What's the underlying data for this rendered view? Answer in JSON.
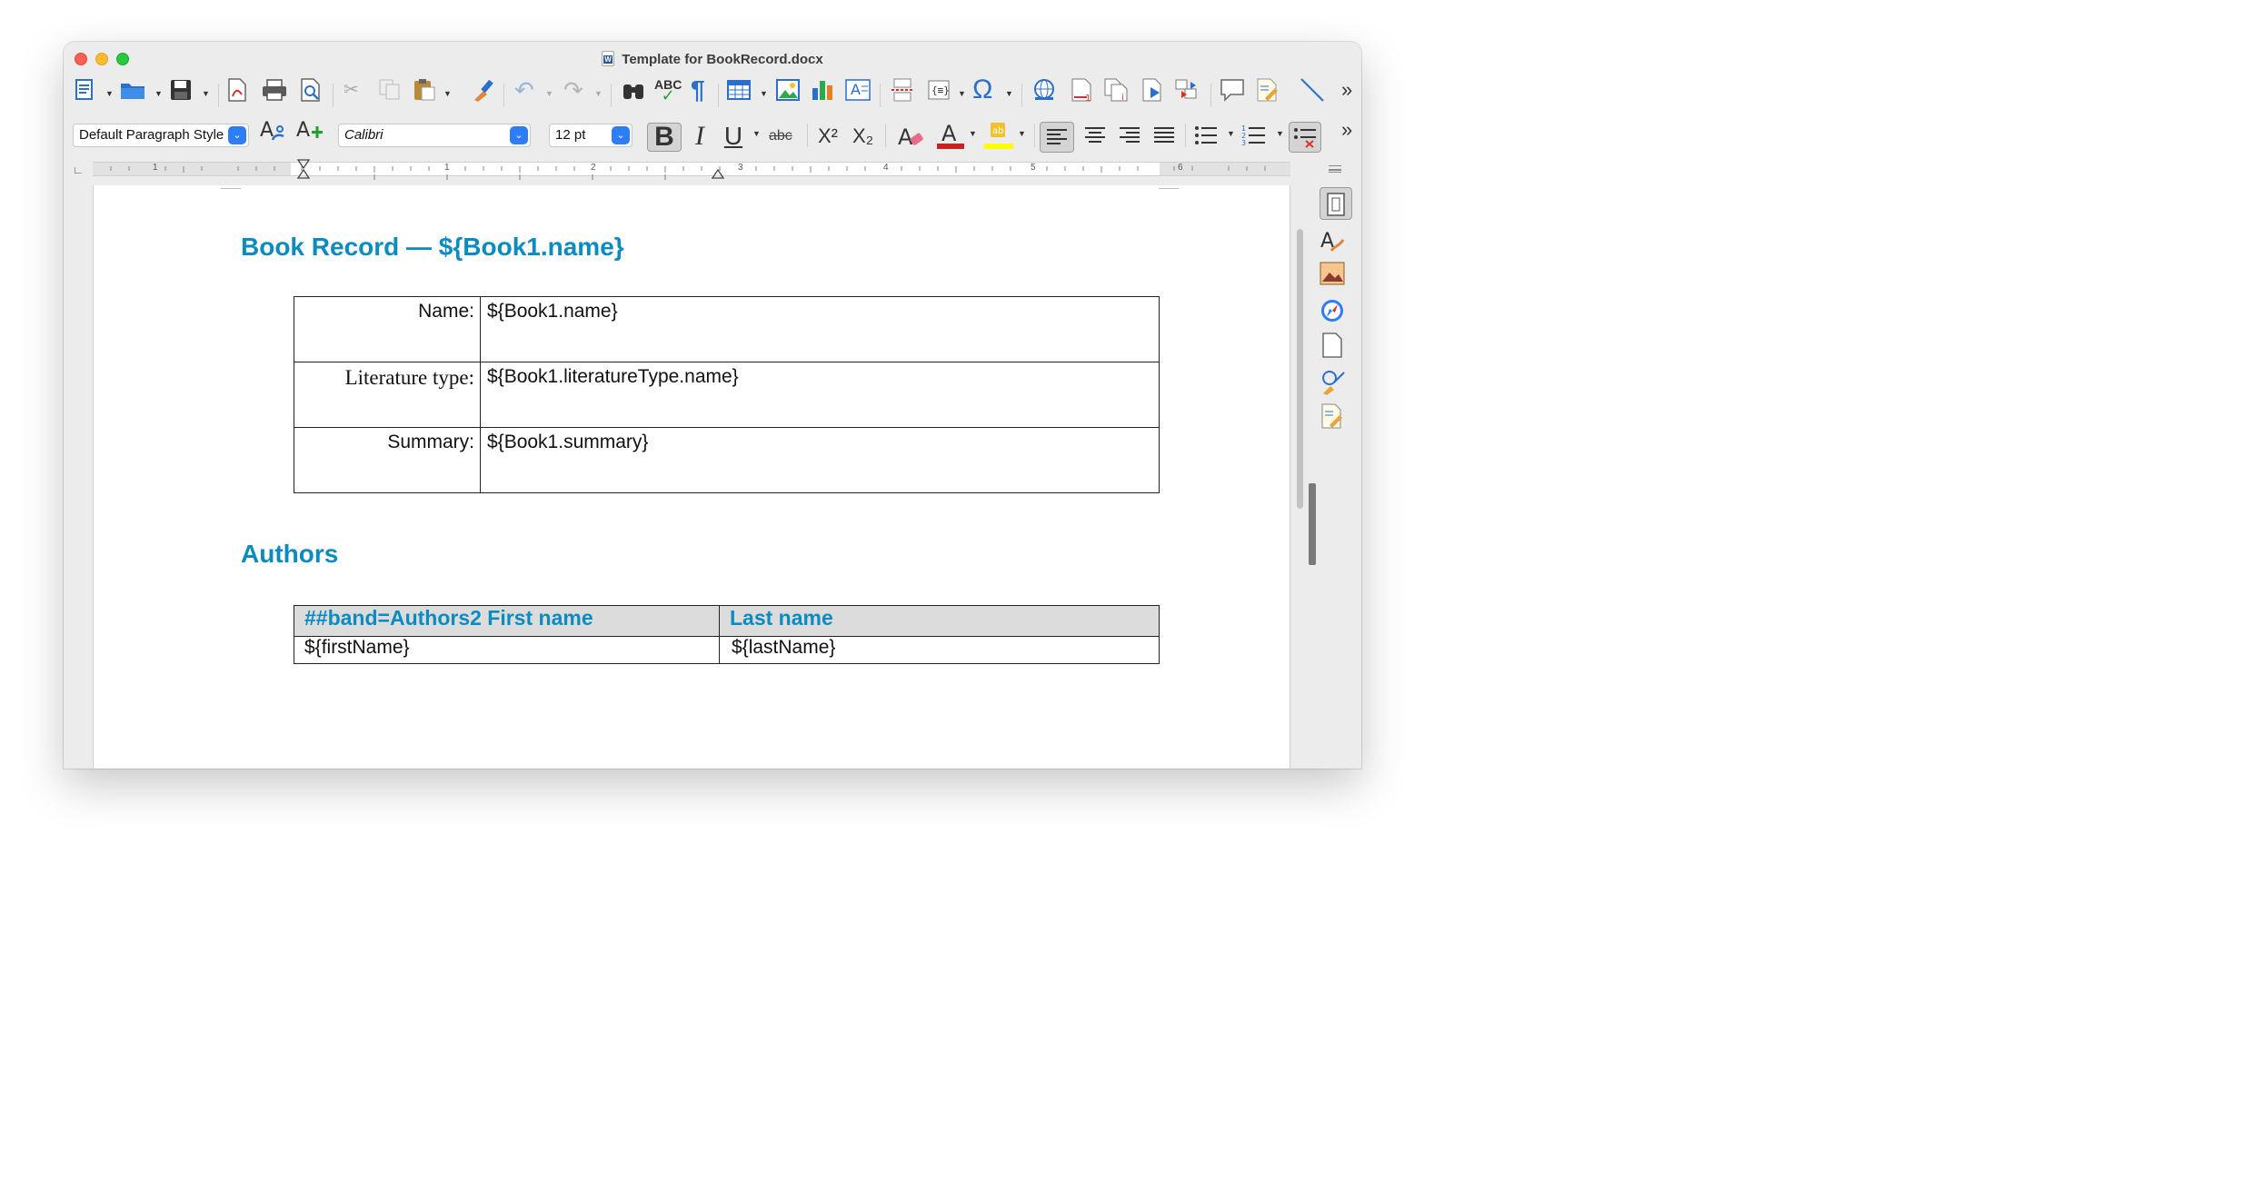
{
  "window": {
    "title": "Template for BookRecord.docx"
  },
  "toolbar1": {
    "overflow": "»"
  },
  "toolbar2": {
    "paragraph_style": "Default Paragraph Style",
    "font_name": "Calibri",
    "font_size": "12 pt",
    "bold": "B",
    "italic": "I",
    "underline": "U",
    "strikethrough": "abc",
    "superscript": "X²",
    "subscript": "X₂",
    "overflow": "»"
  },
  "ruler": {
    "marks": [
      "1",
      "1",
      "2",
      "3",
      "4",
      "5",
      "6"
    ]
  },
  "document": {
    "heading1": "Book Record —  ${Book1.name}",
    "record_table": [
      {
        "label": "Name:",
        "value": "${Book1.name}"
      },
      {
        "label": "Literature type:",
        "value": "${Book1.literatureType.name}"
      },
      {
        "label": "Summary:",
        "value": "${Book1.summary}"
      }
    ],
    "heading2": "Authors",
    "authors_header": [
      "##band=Authors2 First name",
      "Last name"
    ],
    "authors_row": [
      "${firstName}",
      "${lastName}"
    ]
  },
  "colors": {
    "heading": "#0b8bc0",
    "accent": "#2e7cf6"
  }
}
